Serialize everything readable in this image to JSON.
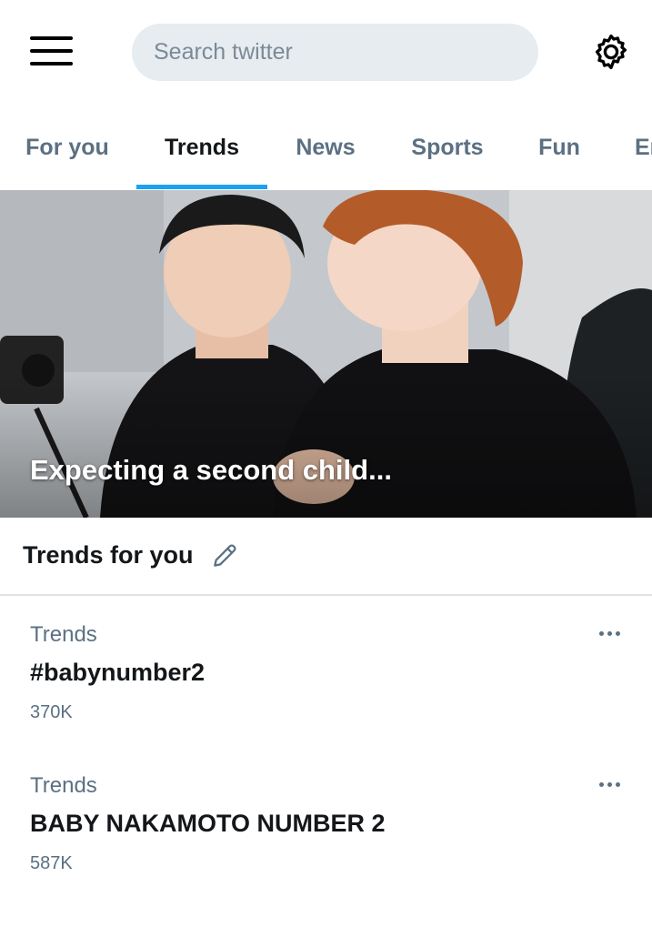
{
  "header": {
    "menu_icon": "hamburger-menu-icon",
    "search_placeholder": "Search twitter",
    "settings_icon": "gear-icon"
  },
  "tabs": [
    {
      "label": "For you",
      "active": false
    },
    {
      "label": "Trends",
      "active": true
    },
    {
      "label": "News",
      "active": false
    },
    {
      "label": "Sports",
      "active": false
    },
    {
      "label": "Fun",
      "active": false
    },
    {
      "label": "Er",
      "active": false
    }
  ],
  "accent_color": "#1da1f2",
  "hero": {
    "caption": "Expecting a second child..."
  },
  "section": {
    "title": "Trends for you",
    "edit_icon": "pencil-icon"
  },
  "trends": [
    {
      "category": "Trends",
      "name": "#babynumber2",
      "count": "370K"
    },
    {
      "category": "Trends",
      "name": "BABY NAKAMOTO NUMBER 2",
      "count": "587K"
    }
  ]
}
